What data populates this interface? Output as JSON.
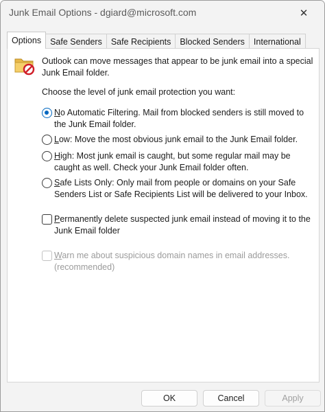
{
  "window": {
    "title": "Junk Email Options - dgiard@microsoft.com",
    "close_glyph": "✕"
  },
  "tabs": [
    {
      "label": "Options",
      "active": true
    },
    {
      "label": "Safe Senders",
      "active": false
    },
    {
      "label": "Safe Recipients",
      "active": false
    },
    {
      "label": "Blocked Senders",
      "active": false
    },
    {
      "label": "International",
      "active": false
    }
  ],
  "options_panel": {
    "icon": "junk-folder-icon",
    "intro_line1": "Outlook can move messages that appear to be junk email into a special",
    "intro_line2": "Junk Email folder.",
    "level_prompt": "Choose the level of junk email protection you want:",
    "levels": [
      {
        "accel": "N",
        "line1_rest": "o Automatic Filtering. Mail from blocked senders is still moved to",
        "line2": "the Junk Email folder.",
        "selected": true
      },
      {
        "accel": "L",
        "line1_rest": "ow: Move the most obvious junk email to the Junk Email folder.",
        "line2": "",
        "selected": false
      },
      {
        "accel": "H",
        "line1_rest": "igh: Most junk email is caught, but some regular mail may be",
        "line2": "caught as well. Check your Junk Email folder often.",
        "selected": false
      },
      {
        "accel": "S",
        "line1_rest": "afe Lists Only: Only mail from people or domains on your Safe",
        "line2": "Senders List or Safe Recipients List will be delivered to your Inbox.",
        "selected": false
      }
    ],
    "permanent_delete": {
      "accel": "P",
      "line1_rest": "ermanently delete suspected junk email instead of moving it to the",
      "line2": "Junk Email folder",
      "checked": false
    },
    "warn_domains": {
      "accel": "W",
      "line1_rest": "arn me about suspicious domain names in email addresses.",
      "line2": "(recommended)",
      "checked": false,
      "enabled": false
    }
  },
  "buttons": {
    "ok": "OK",
    "cancel": "Cancel",
    "apply": "Apply"
  },
  "colors": {
    "accent": "#0067c0",
    "disabled_text": "#9b9b9b"
  }
}
